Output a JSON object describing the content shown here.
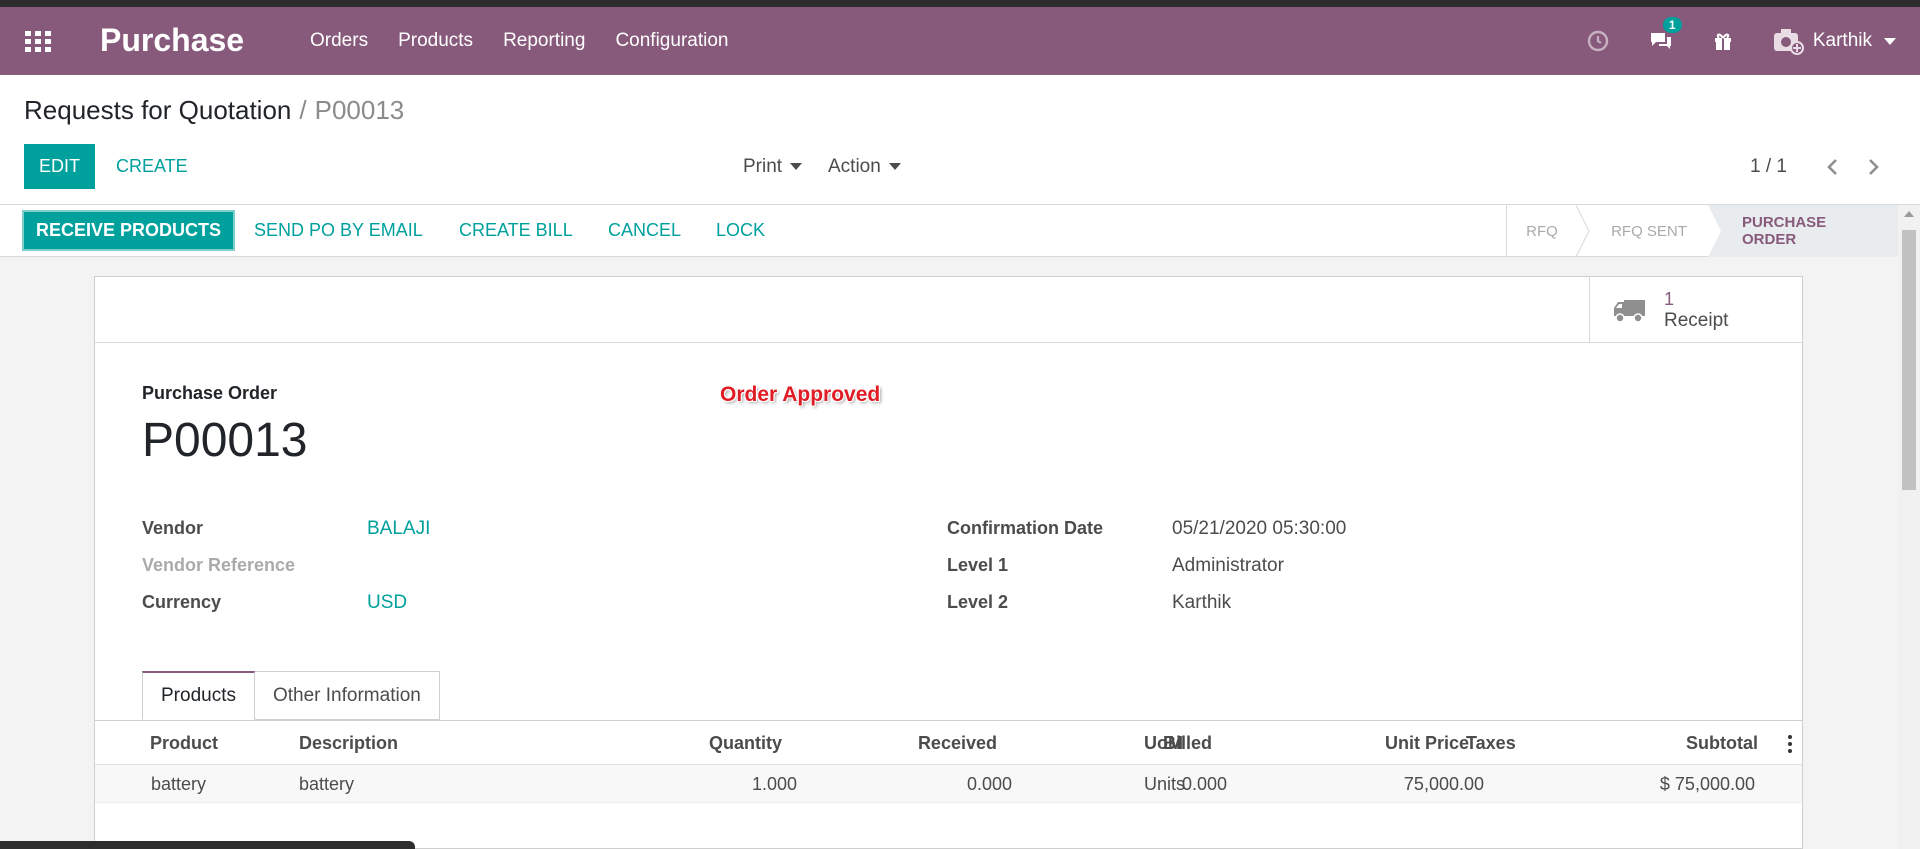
{
  "navbar": {
    "brand": "Purchase",
    "menu": [
      "Orders",
      "Products",
      "Reporting",
      "Configuration"
    ],
    "chat_badge": "1",
    "user_name": "Karthik",
    "accent": "#875a7b"
  },
  "breadcrumb": {
    "parent": "Requests for Quotation",
    "separator": "/",
    "current": "P00013"
  },
  "actions": {
    "edit": "EDIT",
    "create": "CREATE",
    "print": "Print",
    "action": "Action",
    "pager": "1 / 1"
  },
  "statusbar": {
    "buttons": [
      "RECEIVE PRODUCTS",
      "SEND PO BY EMAIL",
      "CREATE BILL",
      "CANCEL",
      "LOCK"
    ],
    "stages": [
      "RFQ",
      "RFQ SENT",
      "PURCHASE ORDER"
    ],
    "active_stage": "PURCHASE ORDER"
  },
  "smart_button": {
    "count": "1",
    "label": "Receipt",
    "icon": "truck-icon"
  },
  "form": {
    "title_label": "Purchase Order",
    "number": "P00013",
    "ribbon": "Order Approved",
    "vendor_label": "Vendor",
    "vendor": "BALAJI",
    "vendor_ref_label": "Vendor Reference",
    "currency_label": "Currency",
    "currency": "USD",
    "confirmation_label": "Confirmation Date",
    "confirmation_date": "05/21/2020 05:30:00",
    "level1_label": "Level 1",
    "level1": "Administrator",
    "level2_label": "Level 2",
    "level2": "Karthik"
  },
  "tabs": [
    "Products",
    "Other Information"
  ],
  "lines": {
    "headers": [
      "Product",
      "Description",
      "Quantity",
      "Received",
      "Billed",
      "UoM",
      "Unit Price",
      "Taxes",
      "Subtotal"
    ],
    "rows": [
      {
        "product": "battery",
        "description": "battery",
        "quantity": "1.000",
        "received": "0.000",
        "billed": "0.000",
        "uom": "Units",
        "unit_price": "75,000.00",
        "taxes": "",
        "subtotal": "$ 75,000.00"
      }
    ]
  }
}
